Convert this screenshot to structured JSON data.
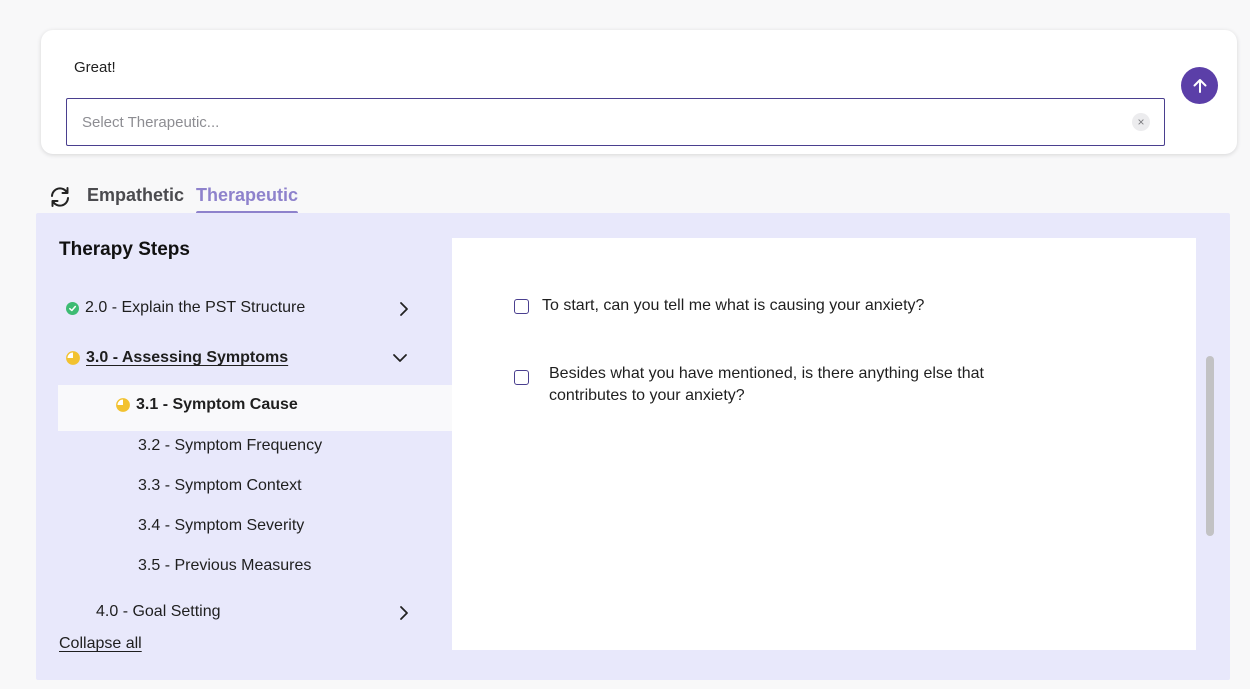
{
  "composer": {
    "message": "Great!",
    "select_placeholder": "Select Therapeutic...",
    "clear_glyph": "×"
  },
  "modes": {
    "tabs": [
      {
        "label": "Empathetic",
        "active": false
      },
      {
        "label": "Therapeutic",
        "active": true
      }
    ]
  },
  "steps": {
    "title": "Therapy Steps",
    "items": [
      {
        "label": "2.0 - Explain the PST Structure",
        "status": "complete"
      },
      {
        "label": "3.0 - Assessing Symptoms",
        "status": "in-progress"
      },
      {
        "label": "3.1 - Symptom Cause",
        "status": "in-progress"
      },
      {
        "label": "3.2 - Symptom Frequency"
      },
      {
        "label": "3.3 - Symptom Context"
      },
      {
        "label": "3.4 - Symptom Severity"
      },
      {
        "label": "3.5 - Previous Measures"
      },
      {
        "label": "4.0 - Goal Setting"
      }
    ],
    "collapse_all": "Collapse all"
  },
  "questions": {
    "items": [
      {
        "text": "To start, can you tell me what is causing your anxiety?",
        "checked": false
      },
      {
        "text": "Besides what you have mentioned, is there anything else that contributes to your anxiety?",
        "checked": false
      }
    ]
  },
  "colors": {
    "accent": "#5b3fa8",
    "tab_active": "#8e82cc",
    "panel_bg": "#e8e8fb",
    "complete": "#3dbb73",
    "in_progress": "#f2c230"
  }
}
